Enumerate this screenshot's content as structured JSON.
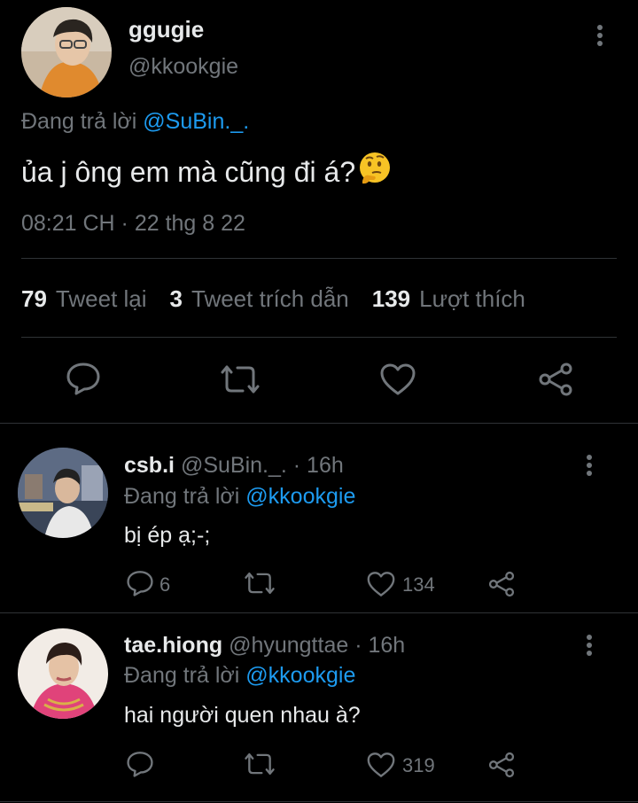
{
  "main_tweet": {
    "display_name": "ggugie",
    "handle": "@kkookgie",
    "reply_prefix": "Đang trả lời",
    "reply_mention": "@SuBin._.",
    "text": "ủa j ông em mà cũng đi á?",
    "emoji": "🤔",
    "timestamp": "08:21 CH · 22 thg 8 22",
    "stats": {
      "retweets_num": "79",
      "retweets_label": "Tweet lại",
      "quotes_num": "3",
      "quotes_label": "Tweet trích dẫn",
      "likes_num": "139",
      "likes_label": "Lượt thích"
    }
  },
  "replies": [
    {
      "display_name": "csb.i",
      "handle": "@SuBin._.",
      "time": "· 16h",
      "reply_prefix": "Đang trả lời",
      "reply_mention": "@kkookgie",
      "text": "bị ép ạ;-;",
      "reply_count": "6",
      "retweet_count": "",
      "like_count": "134"
    },
    {
      "display_name": "tae.hiong",
      "handle": "@hyungttae",
      "time": "· 16h",
      "reply_prefix": "Đang trả lời",
      "reply_mention": "@kkookgie",
      "text": "hai người quen nhau à?",
      "reply_count": "",
      "retweet_count": "",
      "like_count": "319"
    }
  ],
  "colors": {
    "background": "#000000",
    "text_primary": "#e7e9ea",
    "text_secondary": "#71767b",
    "accent": "#1d9bf0",
    "divider": "#2f3336"
  },
  "icons": [
    "reply-icon",
    "retweet-icon",
    "like-icon",
    "share-icon",
    "more-icon"
  ]
}
